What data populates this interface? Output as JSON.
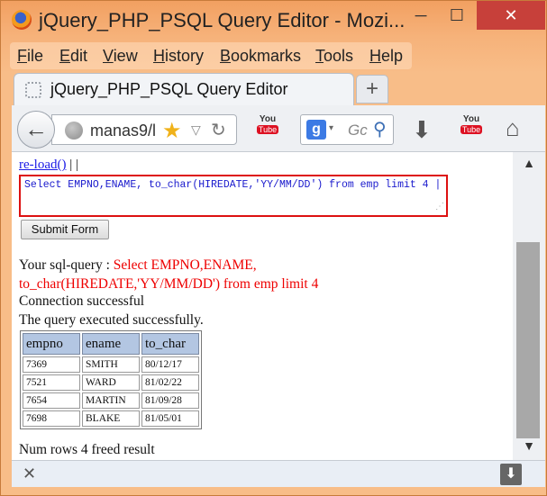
{
  "window": {
    "title": "jQuery_PHP_PSQL Query Editor - Mozi...",
    "min_glyph": "─",
    "max_glyph": "☐",
    "close_glyph": "✕"
  },
  "menu": {
    "items": [
      "File",
      "Edit",
      "View",
      "History",
      "Bookmarks",
      "Tools",
      "Help"
    ]
  },
  "tab": {
    "title": "jQuery_PHP_PSQL Query Editor",
    "new_tab_label": "+"
  },
  "nav": {
    "back_glyph": "←",
    "url": "manas9/l",
    "star_glyph": "★",
    "dropmarker_glyph": "▽",
    "reload_glyph": "↻",
    "youtube_top": "You",
    "youtube_bottom": "Tube",
    "search_engine_label": "g",
    "search_engine_drop": "▾",
    "search_placeholder": "Gc",
    "search_glyph": "⚲",
    "download_glyph": "⬇",
    "home_glyph": "⌂"
  },
  "content": {
    "reload_link": "re-load()",
    "reload_suffix": " | |",
    "query_text": "Select EMPNO,ENAME, to_char(HIREDATE,'YY/MM/DD') from emp limit 4 |",
    "submit_label": "Submit Form",
    "sql_prefix": "Your sql-query : ",
    "sql_query": "Select EMPNO,ENAME, to_char(HIREDATE,'YY/MM/DD') from emp limit 4",
    "connection_msg": "Connection successful",
    "exec_msg": "The query executed successfully.",
    "table": {
      "headers": [
        "empno",
        "ename",
        "to_char"
      ],
      "rows": [
        [
          "7369",
          "SMITH",
          "80/12/17"
        ],
        [
          "7521",
          "WARD",
          "81/02/22"
        ],
        [
          "7654",
          "MARTIN",
          "81/09/28"
        ],
        [
          "7698",
          "BLAKE",
          "81/05/01"
        ]
      ]
    },
    "numrows_msg": "Num rows 4 freed result"
  },
  "scrollbar": {
    "up_glyph": "▲",
    "down_glyph": "▼",
    "position_fraction": 0.3
  },
  "bottombar": {
    "close_glyph": "✕",
    "download_glyph": "⬇"
  }
}
